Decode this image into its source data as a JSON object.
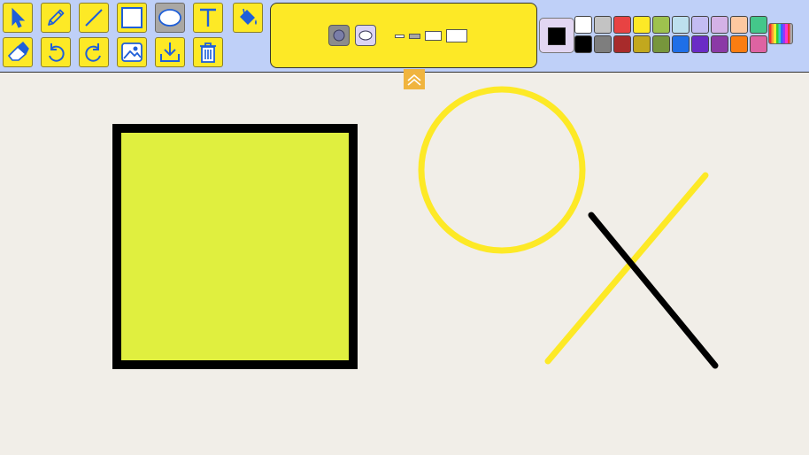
{
  "tools": {
    "row1": [
      "select",
      "pencil",
      "line",
      "rectangle",
      "ellipse",
      "text",
      "fill"
    ],
    "row2": [
      "eraser",
      "undo",
      "redo",
      "image",
      "download",
      "delete"
    ],
    "active": "ellipse"
  },
  "shape_options": {
    "styles": [
      "outline-fill",
      "outline"
    ],
    "active_style": "outline-fill",
    "sizes": 4,
    "active_size": 1
  },
  "colors": {
    "current": "#000000",
    "palette_row1": [
      "#ffffff",
      "#c3c3c3",
      "#e84343",
      "#fde926",
      "#9ec24e",
      "#bde0ee",
      "#c3bcf2",
      "#d4b2e6",
      "#fdc8a0",
      "#44c78a"
    ],
    "palette_row2": [
      "#000000",
      "#7e7e7e",
      "#a82b2b",
      "#c2a81e",
      "#77963c",
      "#1f6fe8",
      "#6a2bc6",
      "#8b3aa6",
      "#fb7d11",
      "#de63a2"
    ]
  },
  "canvas_shapes": {
    "rect_fill": "#e0ef3f",
    "rect_stroke": "#000000",
    "circle_stroke": "#fde926",
    "line_yellow": "#fde926",
    "line_black": "#000000"
  }
}
